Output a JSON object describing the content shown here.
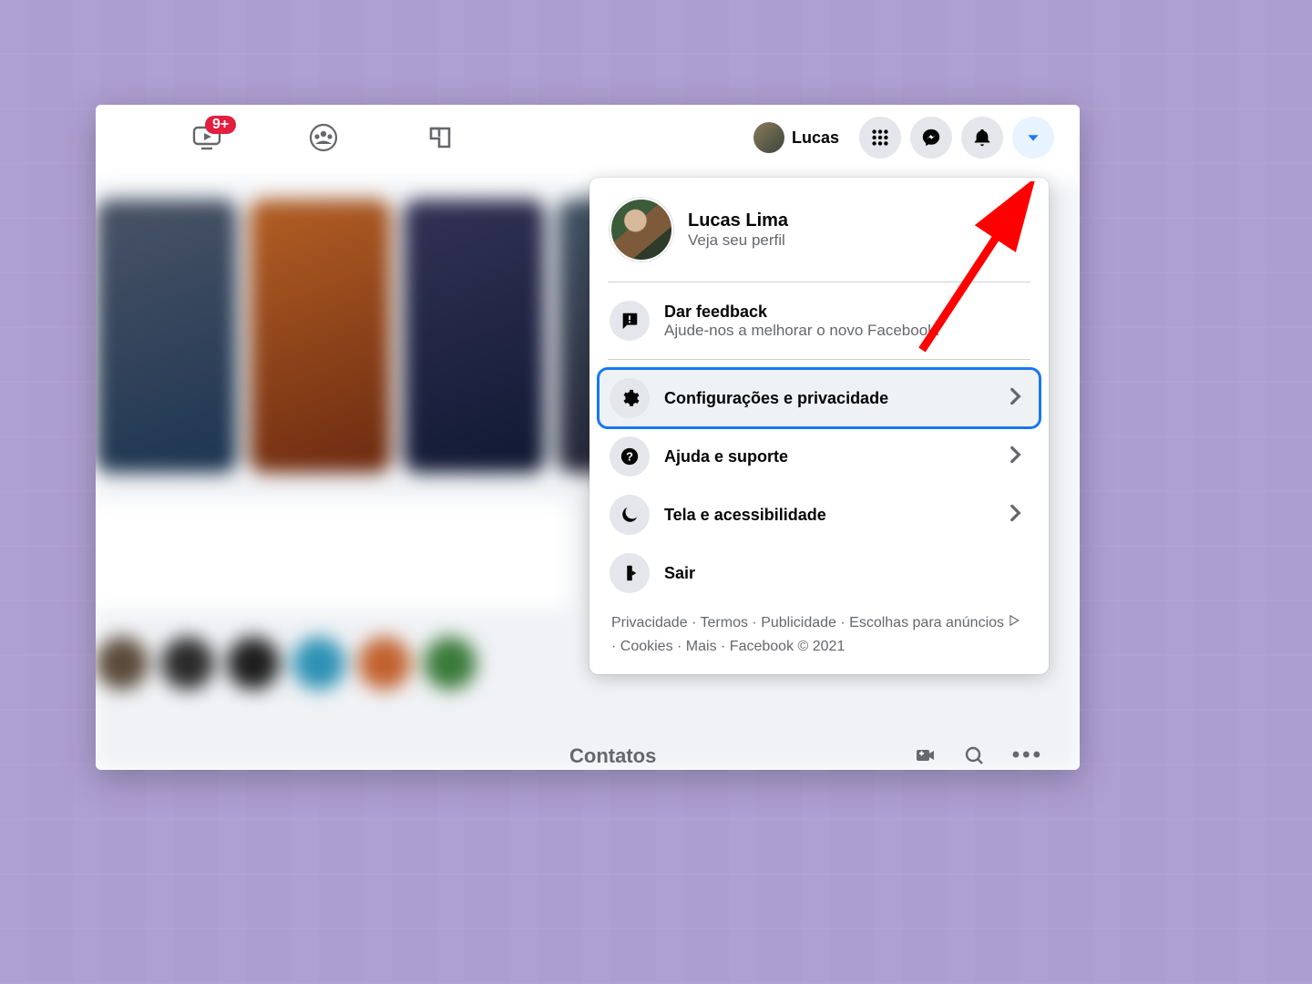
{
  "topbar": {
    "watch_badge": "9+",
    "profile_name": "Lucas"
  },
  "dropdown": {
    "profile": {
      "name": "Lucas Lima",
      "sub": "Veja seu perfil"
    },
    "feedback": {
      "title": "Dar feedback",
      "sub": "Ajude-nos a melhorar o novo Facebook."
    },
    "items": {
      "settings": "Configurações e privacidade",
      "help": "Ajuda e suporte",
      "display": "Tela e acessibilidade",
      "logout": "Sair"
    },
    "footer": "Privacidade · Termos · Publicidade · Escolhas para anúncios ",
    "footer2": " · Cookies · Mais · Facebook © 2021"
  },
  "contacts_label": "Contatos"
}
